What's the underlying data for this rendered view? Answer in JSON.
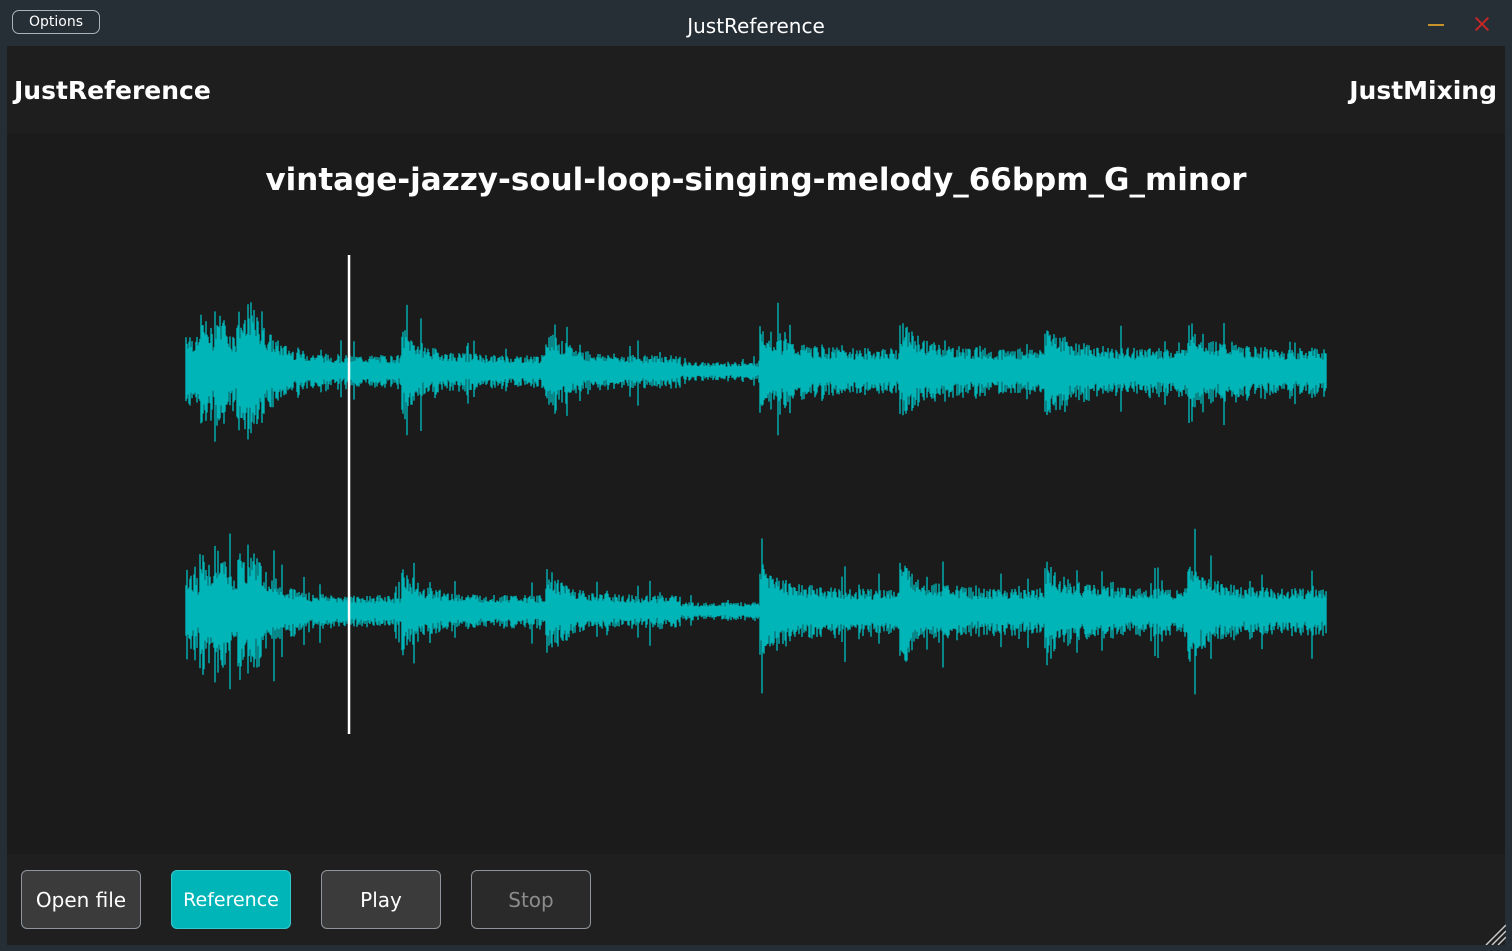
{
  "window": {
    "title": "JustReference",
    "options_label": "Options",
    "minimize_color": "#c8922a",
    "close_color": "#c02828"
  },
  "header": {
    "brand_left": "JustReference",
    "brand_right": "JustMixing"
  },
  "track": {
    "filename": "vintage-jazzy-soul-loop-singing-melody_66bpm_G_minor",
    "channels": 2,
    "waveform_color": "#00b5b8",
    "playhead_position": 0.143
  },
  "footer": {
    "open_file_label": "Open file",
    "reference_label": "Reference",
    "play_label": "Play",
    "stop_label": "Stop"
  },
  "colors": {
    "accent": "#00b5b8",
    "background": "#1b1b1b"
  }
}
